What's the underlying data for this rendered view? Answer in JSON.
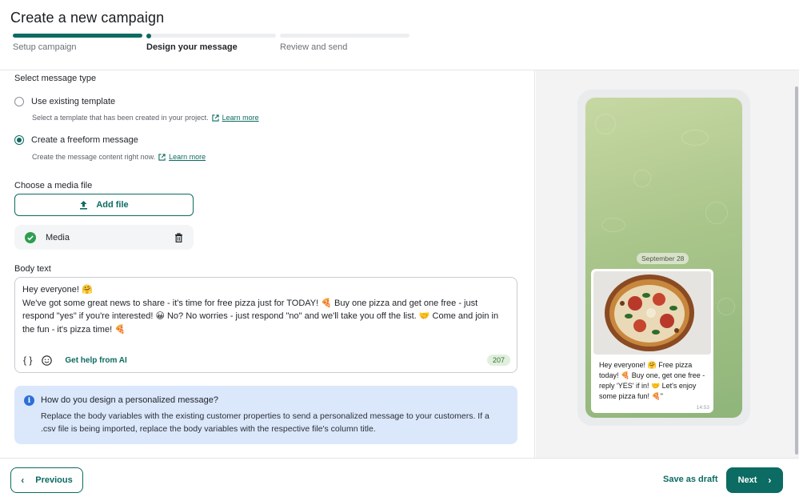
{
  "header": {
    "title": "Create a new campaign",
    "steps": [
      {
        "label": "Setup campaign",
        "state": "done"
      },
      {
        "label": "Design your message",
        "state": "active"
      },
      {
        "label": "Review and send",
        "state": "pending"
      }
    ]
  },
  "message_type": {
    "label": "Select message type",
    "options": [
      {
        "label": "Use existing template",
        "description": "Select a template that has been created in your project.",
        "link": "Learn more",
        "selected": false
      },
      {
        "label": "Create a freeform message",
        "description": "Create the message content right now.",
        "link": "Learn more",
        "selected": true
      }
    ]
  },
  "media": {
    "label": "Choose a media file",
    "add_button": "Add file",
    "file_name": "Media"
  },
  "body": {
    "label": "Body text",
    "text": "Hey everyone! 🤗\nWe've got some great news to share - it's time for free pizza just for TODAY! 🍕 Buy one pizza and get one free - just respond \"yes\" if you're interested! 😀 No? No worries - just respond \"no\" and we'll take you off the list. 🤝 Come and join in the fun - it's pizza time! 🍕",
    "ai_help": "Get help from AI",
    "char_count": "207"
  },
  "info": {
    "title": "How do you design a personalized message?",
    "text": "Replace the body variables with the existing customer properties to send a personalized message to your customers. If a .csv file is being imported, replace the body variables with the respective file's column title."
  },
  "preview": {
    "date": "September 28",
    "message": "Hey everyone! 🤗 Free pizza today! 🍕 Buy one, get one free - reply 'YES' if in! 🤝 Let's enjoy some pizza fun! 🍕\"",
    "time": "14:53"
  },
  "footer": {
    "previous": "Previous",
    "save_draft": "Save as draft",
    "next": "Next"
  },
  "colors": {
    "accent": "#0c6b62",
    "info_bg": "#dbe7fb",
    "count_bg": "#dff0dc"
  }
}
